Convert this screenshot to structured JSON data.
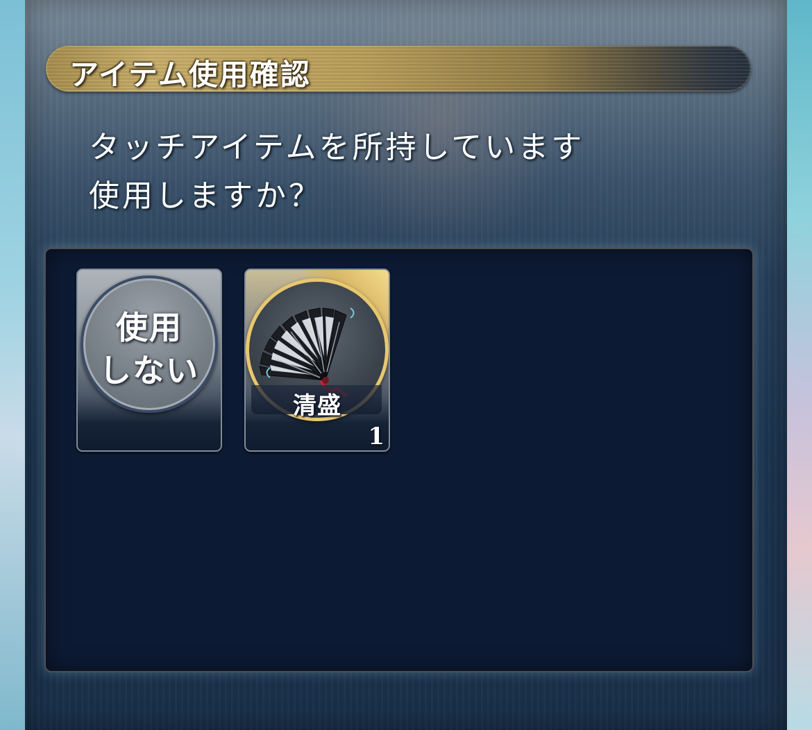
{
  "dialog": {
    "title": "アイテム使用確認",
    "message_line1": "タッチアイテムを所持しています",
    "message_line2": "使用しますか？"
  },
  "options": {
    "skip": {
      "label_line1": "使用",
      "label_line2": "しない"
    },
    "item": {
      "name": "清盛",
      "count": "1",
      "icon": "feather-fan-icon"
    }
  },
  "colors": {
    "panel_background": "#0d1a33",
    "title_banner_gold": "#c7ad6a",
    "item_frame_gold": "#e8c76f"
  }
}
